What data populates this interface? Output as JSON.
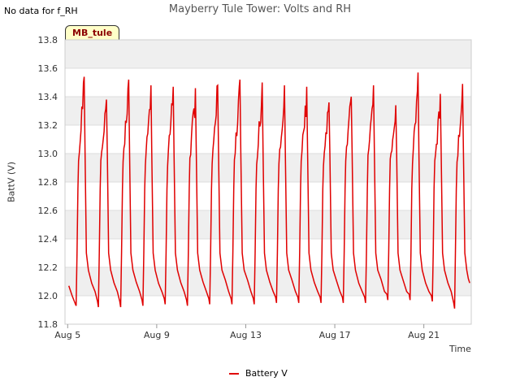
{
  "no_data_note": "No data for f_RH",
  "site_tag": "MB_tule",
  "colors": {
    "series": "#e00000",
    "band": "#efefef",
    "grid": "#dddddd"
  },
  "chart_data": {
    "type": "line",
    "title": "Mayberry Tule Tower: Volts and RH",
    "xlabel": "Time",
    "ylabel": "BattV (V)",
    "ylim": [
      11.8,
      13.8
    ],
    "y_ticks": [
      11.8,
      12.0,
      12.2,
      12.4,
      12.6,
      12.8,
      13.0,
      13.2,
      13.4,
      13.6,
      13.8
    ],
    "y_tick_labels": [
      "11.8",
      "12.0",
      "12.2",
      "12.4",
      "12.6",
      "12.8",
      "13.0",
      "13.2",
      "13.4",
      "13.6",
      "13.8"
    ],
    "x_unit": "days since Aug 5",
    "xlim": [
      0,
      18
    ],
    "x_ticks": [
      0,
      4,
      8,
      12,
      16
    ],
    "x_tick_labels": [
      "Aug 5",
      "Aug 9",
      "Aug 13",
      "Aug 17",
      "Aug 21"
    ],
    "grid": true,
    "legend_position": "bottom-center",
    "series": [
      {
        "name": "Battery V",
        "daily_peaks": [
          13.54,
          13.38,
          13.52,
          13.48,
          13.47,
          13.46,
          13.48,
          13.52,
          13.5,
          13.48,
          13.47,
          13.36,
          13.4,
          13.48,
          13.34,
          13.57,
          13.42,
          13.49
        ],
        "daily_minima": [
          11.92,
          11.92,
          11.93,
          11.94,
          11.93,
          11.94,
          11.94,
          11.94,
          11.95,
          11.95,
          11.95,
          11.95,
          11.95,
          11.97,
          11.97,
          11.96,
          11.91
        ],
        "plateau": 12.95,
        "end_value": 12.09
      }
    ]
  }
}
